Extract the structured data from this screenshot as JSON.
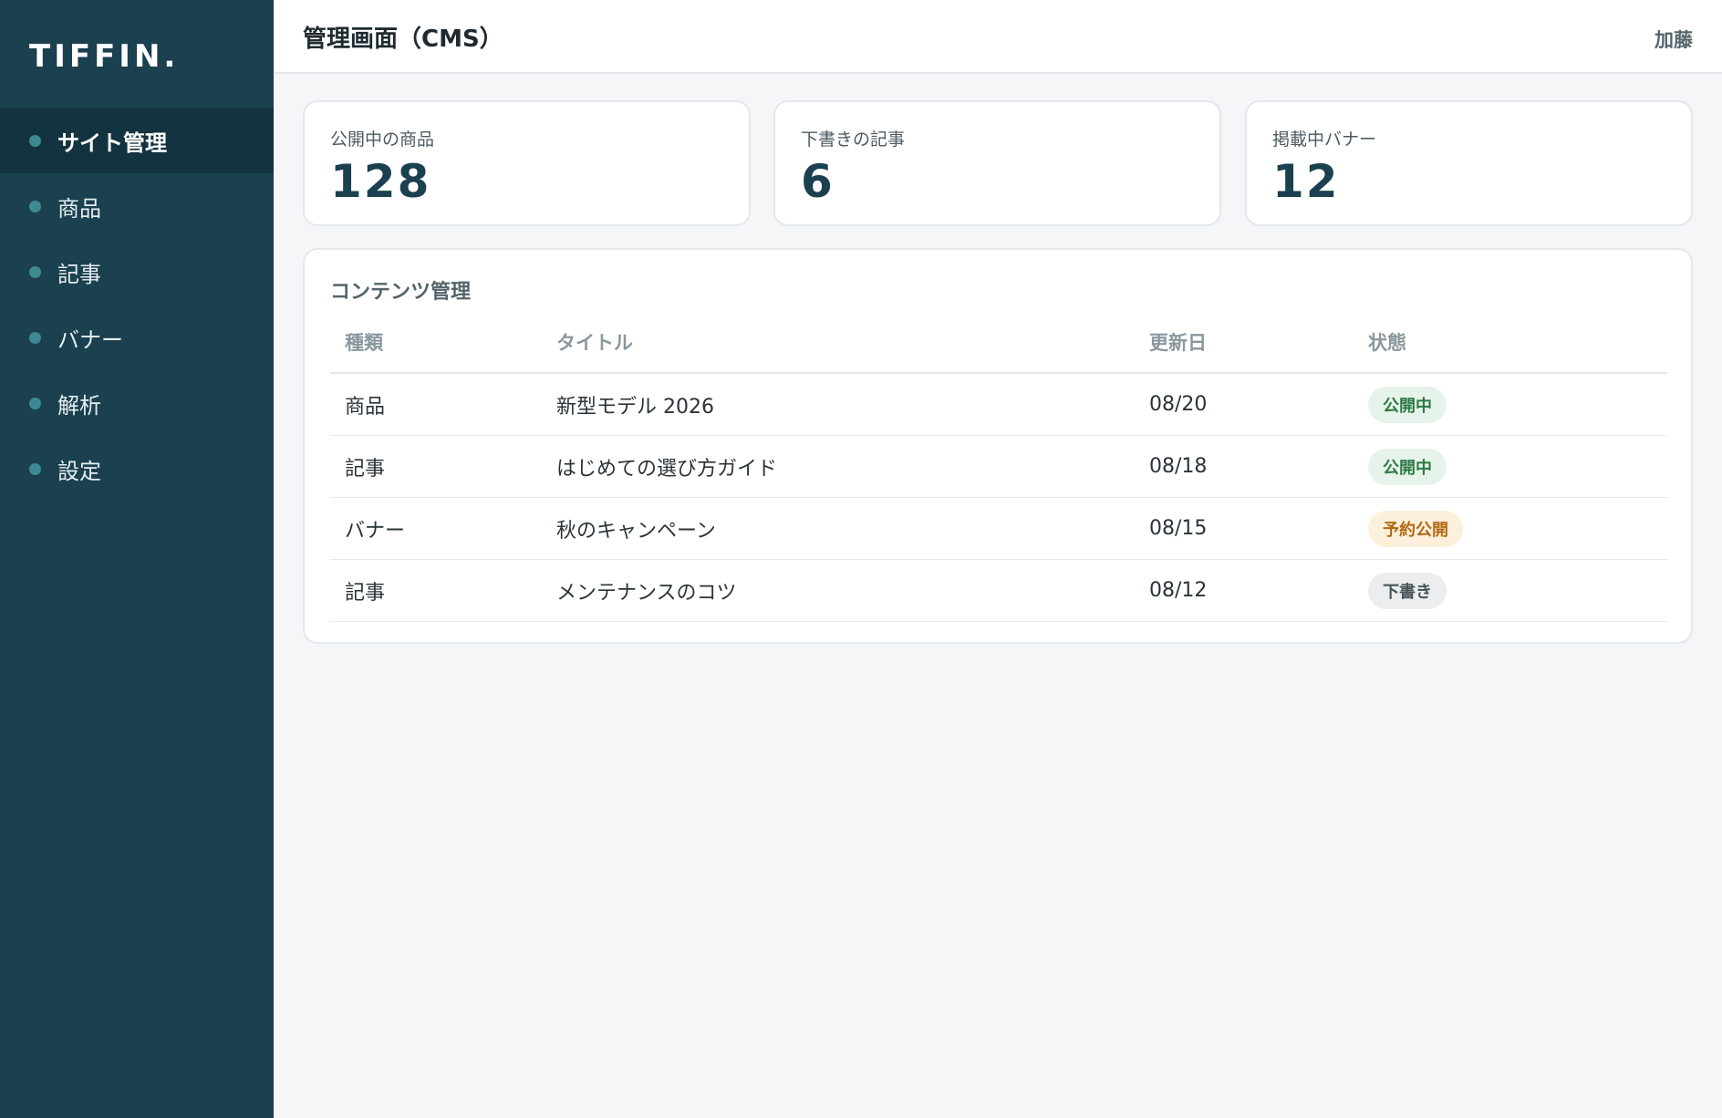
{
  "brand": {
    "logo": "TIFFIN."
  },
  "sidebar": {
    "items": [
      {
        "label": "サイト管理",
        "active": true
      },
      {
        "label": "商品",
        "active": false
      },
      {
        "label": "記事",
        "active": false
      },
      {
        "label": "バナー",
        "active": false
      },
      {
        "label": "解析",
        "active": false
      },
      {
        "label": "設定",
        "active": false
      }
    ]
  },
  "header": {
    "title": "管理画面（CMS）",
    "user": "加藤"
  },
  "stats": [
    {
      "label": "公開中の商品",
      "value": "128"
    },
    {
      "label": "下書きの記事",
      "value": "6"
    },
    {
      "label": "掲載中バナー",
      "value": "12"
    }
  ],
  "content": {
    "title": "コンテンツ管理",
    "columns": [
      "種類",
      "タイトル",
      "更新日",
      "状態"
    ],
    "rows": [
      {
        "type": "商品",
        "title": "新型モデル 2026",
        "date": "08/20",
        "status": "公開中"
      },
      {
        "type": "記事",
        "title": "はじめての選び方ガイド",
        "date": "08/18",
        "status": "公開中"
      },
      {
        "type": "バナー",
        "title": "秋のキャンペーン",
        "date": "08/15",
        "status": "予約公開"
      },
      {
        "type": "記事",
        "title": "メンテナンスのコツ",
        "date": "08/12",
        "status": "下書き"
      }
    ]
  },
  "colors": {
    "sidebar_bg": "#1b404f",
    "sidebar_active": "#143341",
    "nav_dot": "#3e8a93",
    "published": "#2d7a43",
    "scheduled": "#b06a14",
    "draft": "#49545a"
  }
}
